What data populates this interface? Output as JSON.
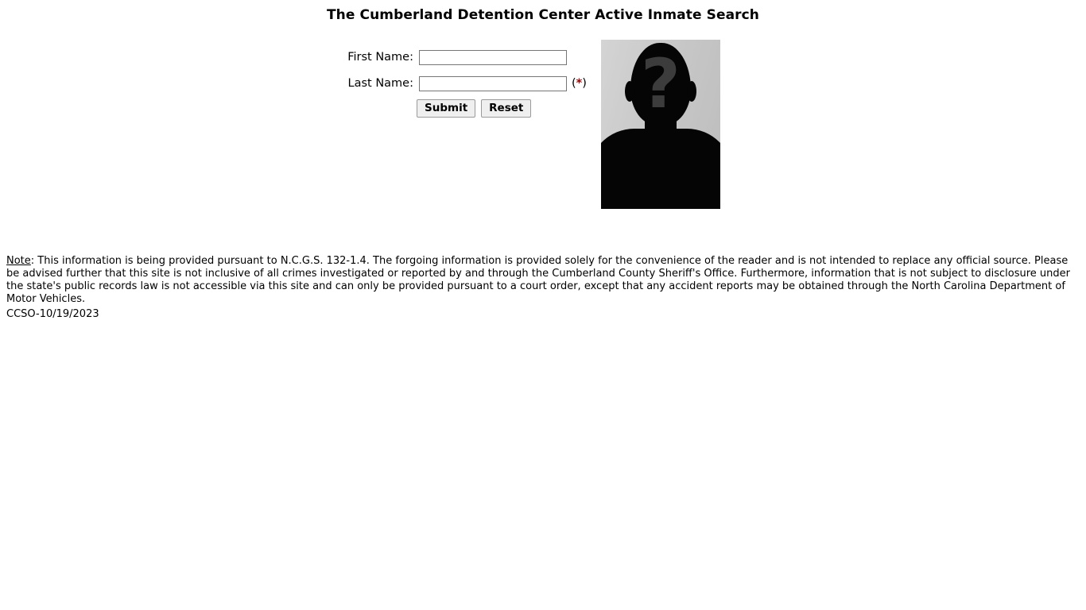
{
  "page": {
    "title": "The Cumberland Detention Center Active Inmate Search"
  },
  "form": {
    "first_name": {
      "label": "First Name:",
      "value": "",
      "placeholder": ""
    },
    "last_name": {
      "label": "Last Name:",
      "value": "",
      "placeholder": ""
    },
    "required_marker": {
      "open": "(",
      "star": "*",
      "close": ")"
    },
    "submit_label": "Submit",
    "reset_label": "Reset"
  },
  "photo": {
    "alt": "inmate-photo-placeholder",
    "question_glyph": "?"
  },
  "note": {
    "label": "Note",
    "separator": ": ",
    "body": "This information is being provided pursuant to N.C.G.S. 132-1.4. The forgoing information is provided solely for the convenience of the reader and is not intended to replace any official source. Please be advised further that this site is not inclusive of all crimes investigated or reported by and through the Cumberland County Sheriff's Office. Furthermore, information that is not subject to disclosure under the state's public records law is not accessible via this site and can only be provided pursuant to a court order, except that any accident reports may be obtained through the North Carolina Department of Motor Vehicles."
  },
  "footer": {
    "stamp": "CCSO-10/19/2023"
  },
  "colors": {
    "required_star": "#a00000",
    "text": "#000000",
    "background": "#ffffff",
    "button_face": "#efefef",
    "input_border": "#767676"
  }
}
